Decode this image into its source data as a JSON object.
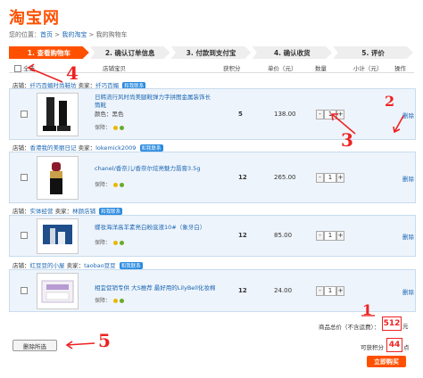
{
  "logo": "淘宝网",
  "breadcrumb": {
    "prefix": "您的位置：",
    "home": "首页",
    "sep1": " > ",
    "mytaobao": "我的淘宝",
    "sep2": " > ",
    "current": "我的购物车"
  },
  "steps": [
    "1. 查看购物车",
    "2. 确认订单信息",
    "3. 付款到支付宝",
    "4. 确认收货",
    "5. 评价"
  ],
  "table_header": {
    "select_all": "全选",
    "shop_product": "店铺宝贝",
    "points": "获积分",
    "price": "单价（元）",
    "qty": "数量",
    "subtotal": "小计（元）",
    "ops": "操作"
  },
  "labels": {
    "shop": "店铺：",
    "seller": "卖家：",
    "contact": "和我联系",
    "guarantee": "保障：",
    "delete": "删除"
  },
  "items": [
    {
      "shop": "纤巧百媚时尚鞋坊",
      "seller": "纤巧百媚",
      "name": "日韩流行风时尚美腿靴弹力字拼图金属装饰长筒靴",
      "color": "颜色：黑色",
      "points": "5",
      "price": "138.00",
      "qty": "1"
    },
    {
      "shop": "香港我的美丽日记",
      "seller": "lokemick2009",
      "name": "chanel/香奈儿/香奈尔炫亮魅力唇膏3.5g",
      "color": "",
      "points": "12",
      "price": "265.00",
      "qty": "1"
    },
    {
      "shop": "实体经营",
      "seller": "林颜店铺",
      "name": "蝶妆海洋高羊素亮白粉底液10#（象牙白）",
      "color": "",
      "points": "12",
      "price": "85.00",
      "qty": "1"
    },
    {
      "shop": "红豆豆的小屋",
      "seller": "taobao豆豆",
      "name": "相宜促销专供 大S推荐 最好用的LilyBell化妆棉",
      "color": "",
      "points": "12",
      "price": "24.00",
      "qty": "1"
    }
  ],
  "summary": {
    "total_label": "商品总价（不含运费）：",
    "total": "512",
    "unit": "元",
    "points_label": "可获积分",
    "points": "44",
    "points_unit": "点"
  },
  "buttons": {
    "delete_selected": "删除所选",
    "buy": "立即购买"
  },
  "annotations": {
    "n1": "1",
    "n2": "2",
    "n3": "3",
    "n4": "4",
    "n5": "5"
  },
  "colors": {
    "brand": "#ff5000",
    "link": "#1a66b3",
    "annotation": "#e22222",
    "row_bg": "#eef4fb"
  }
}
